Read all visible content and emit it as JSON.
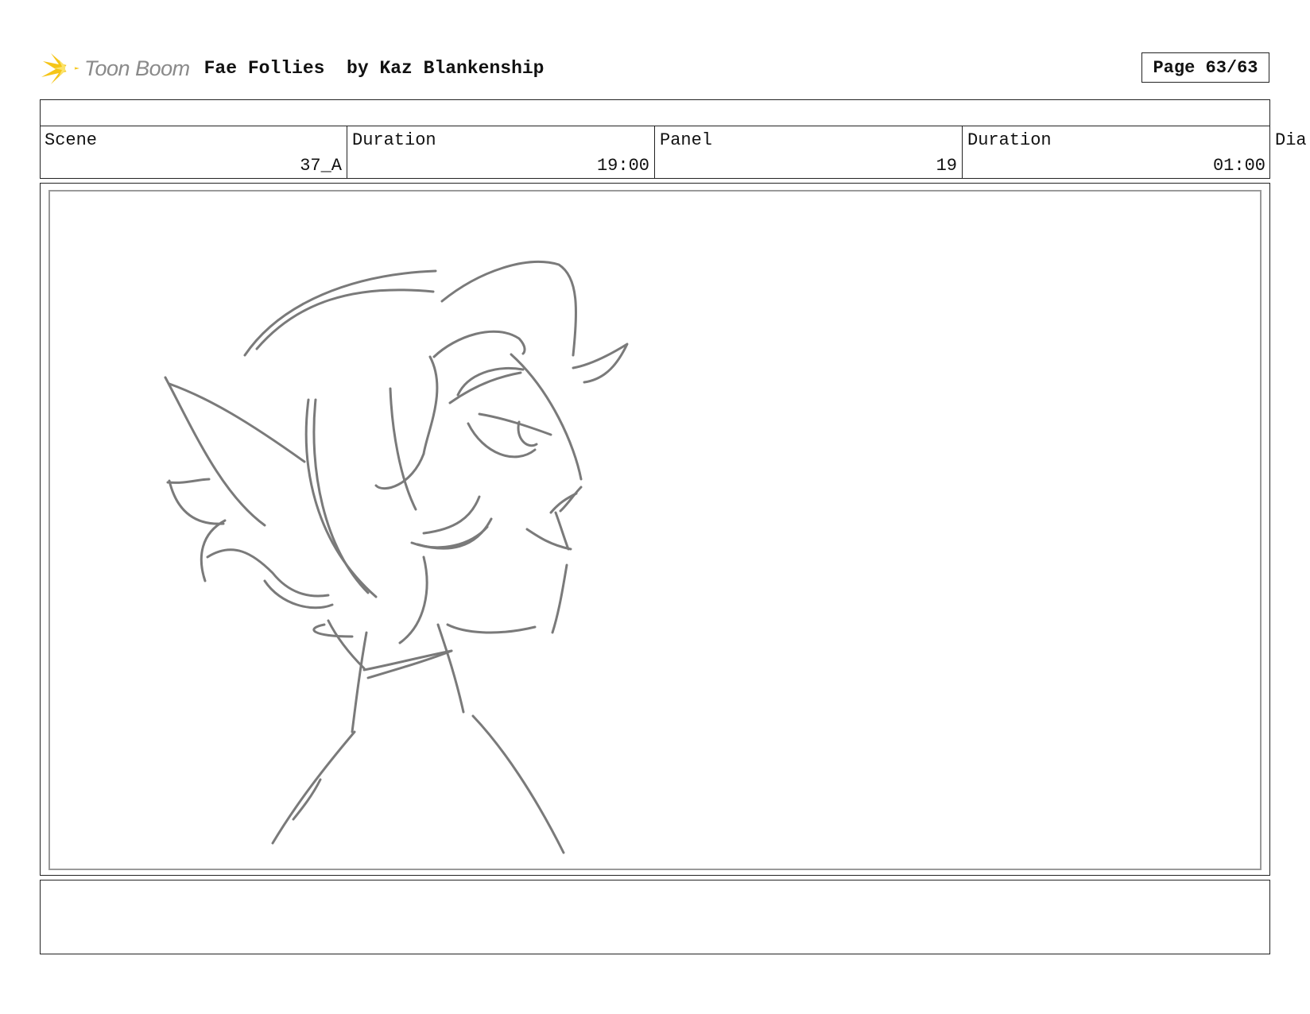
{
  "header": {
    "logo_text": "Toon Boom",
    "title": "Fae Follies  by Kaz Blankenship",
    "page_label": "Page 63/63"
  },
  "panel_info": {
    "scene_label": "Scene",
    "scene_value": "37_A",
    "scene_duration_label": "Duration",
    "scene_duration_value": "19:00",
    "panel_label": "Panel",
    "panel_value": "19",
    "panel_duration_label": "Duration",
    "panel_duration_value": "01:00",
    "dialog_label": "Dia"
  },
  "sketch": {
    "subject": "elf-character-profile",
    "stroke_color": "#7a7a7a"
  },
  "notes": {
    "text": ""
  }
}
